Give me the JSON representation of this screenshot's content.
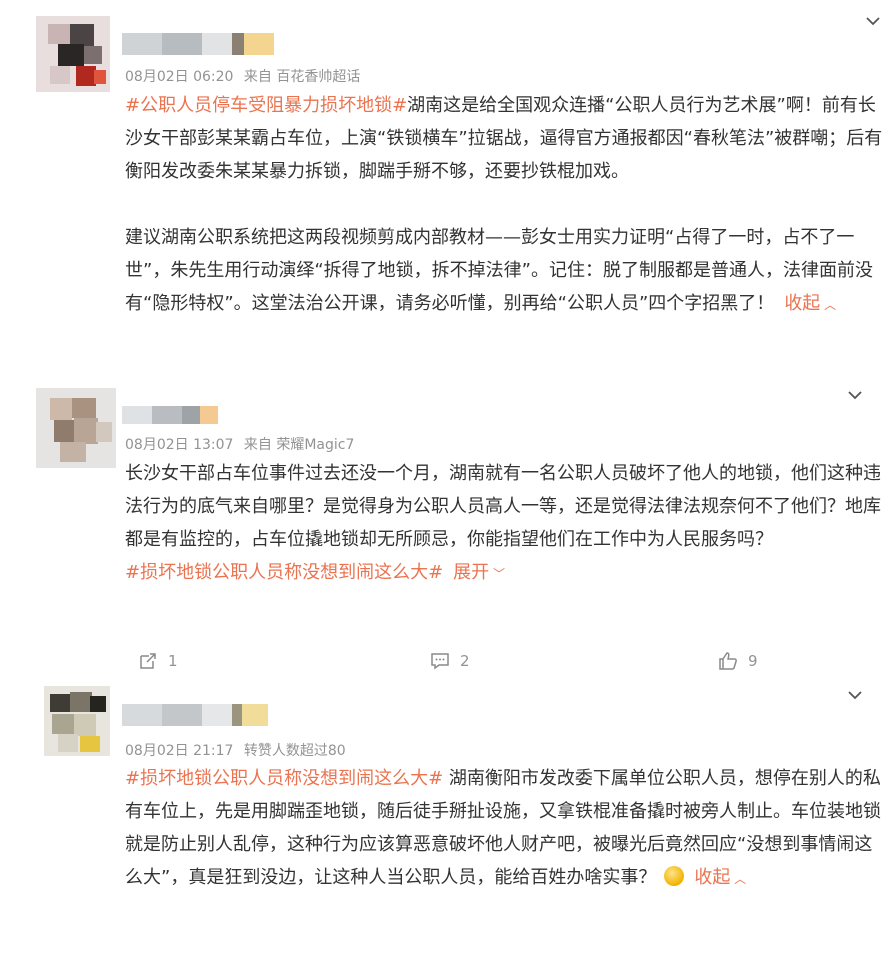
{
  "posts": [
    {
      "meta": {
        "date": "08月02日 06:20",
        "source": "来自 百花香帅超话"
      },
      "paragraph1": {
        "tag": "#公职人员停车受阻暴力损坏地锁#",
        "text": "湖南这是给全国观众连播“公职人员行为艺术展”啊！前有长沙女干部彭某某霸占车位，上演“铁锁横车”拉锯战，逼得官方通报都因“春秋笔法”被群嘲；后有衡阳发改委朱某某暴力拆锁，脚踹手掰不够，还要抄铁棍加戏。"
      },
      "paragraph2": "建议湖南公职系统把这两段视频剪成内部教材——彭女士用实力证明“占得了一时，占不了一世”，朱先生用行动演绎“拆得了地锁，拆不掉法律”。记住：脱了制服都是普通人，法律面前没有“隐形特权”。这堂法治公开课，请务必听懂，别再给“公职人员”四个字招黑了！",
      "toggle": "收起"
    },
    {
      "meta": {
        "date": "08月02日 13:07",
        "source": "来自 荣耀Magic7"
      },
      "text": "长沙女干部占车位事件过去还没一个月，湖南就有一名公职人员破坏了他人的地锁，他们这种违法行为的底气来自哪里？是觉得身为公职人员高人一等，还是觉得法律法规奈何不了他们？地库都是有监控的，占车位撬地锁却无所顾忌，你能指望他们在工作中为人民服务吗？",
      "tag": "#损坏地锁公职人员称没想到闹这么大#",
      "toggle": "展开",
      "actions": {
        "repost": "1",
        "comment": "2",
        "like": "9"
      }
    },
    {
      "meta": {
        "date": "08月02日 21:17",
        "source": "转赞人数超过80"
      },
      "tag": "#损坏地锁公职人员称没想到闹这么大#",
      "text": " 湖南衡阳市发改委下属单位公职人员，想停在别人的私有车位上，先是用脚踹歪地锁，随后徒手掰扯设施，又拿铁棍准备撬时被旁人制止。车位装地锁就是防止别人乱停，这种行为应该算恶意破坏他人财产吧，被曝光后竟然回应“没想到事情闹这么大”，真是狂到没边，让这种人当公职人员，能给百姓办啥实事？",
      "toggle": "收起"
    }
  ],
  "colors": {
    "accent": "#eb7350",
    "meta": "#939393",
    "text": "#333333"
  },
  "icons": {
    "chevron": "chevron-down-icon",
    "repost": "repost-icon",
    "comment": "comment-icon",
    "like": "thumbs-up-icon",
    "emoji": "coin-emoji-icon"
  }
}
